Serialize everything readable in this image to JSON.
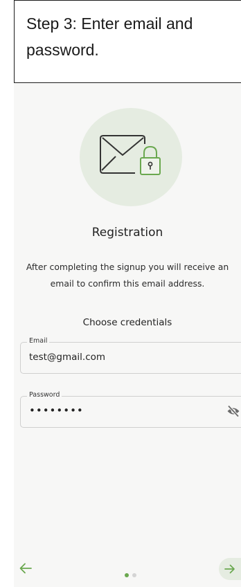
{
  "caption": {
    "text": "Step 3: Enter email and password."
  },
  "hero": {
    "icon": "envelope-lock-icon"
  },
  "registration": {
    "title": "Registration",
    "description": "After completing the signup you will receive an\nemail to confirm this email address.",
    "section_label": "Choose credentials"
  },
  "email_field": {
    "label": "Email",
    "value": "test@gmail.com"
  },
  "password_field": {
    "label": "Password",
    "value": "••••••••",
    "toggle_icon": "eye-off-icon"
  },
  "nav": {
    "back_icon": "arrow-left-icon",
    "next_icon": "arrow-right-icon",
    "pager": {
      "count": 2,
      "active": 0
    }
  },
  "colors": {
    "accent": "#6aa84f",
    "accent_light": "#e5ece1",
    "dot_active": "#6aa84f",
    "dot_inactive": "#d4d4d4",
    "background": "#f7f7f6"
  }
}
